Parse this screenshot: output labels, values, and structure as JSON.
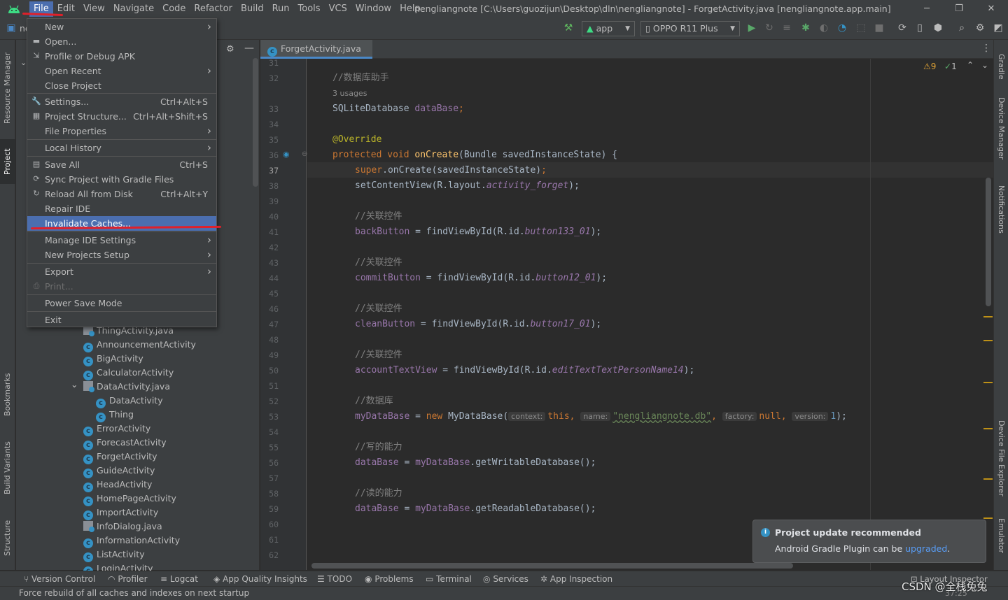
{
  "menubar": {
    "items": [
      "File",
      "Edit",
      "View",
      "Navigate",
      "Code",
      "Refactor",
      "Build",
      "Run",
      "Tools",
      "VCS",
      "Window",
      "Help"
    ]
  },
  "window": {
    "title": "nengliangnote [C:\\Users\\guozijun\\Desktop\\dln\\nengliangnote] - ForgetActivity.java [nengliangnote.app.main]",
    "minimize": "─",
    "maximize": "❐",
    "close": "✕"
  },
  "toolbar": {
    "project_crumb": "ne",
    "run_config": "app",
    "device": "OPPO R11 Plus"
  },
  "file_menu": {
    "items": [
      {
        "label": "New",
        "shortcut": "",
        "submenu": true
      },
      {
        "label": "Open...",
        "shortcut": "",
        "submenu": false
      },
      {
        "label": "Profile or Debug APK",
        "shortcut": "",
        "submenu": false
      },
      {
        "label": "Open Recent",
        "shortcut": "",
        "submenu": true
      },
      {
        "label": "Close Project",
        "shortcut": "",
        "submenu": false
      },
      {
        "label": "Settings...",
        "shortcut": "Ctrl+Alt+S",
        "submenu": false
      },
      {
        "label": "Project Structure...",
        "shortcut": "Ctrl+Alt+Shift+S",
        "submenu": false
      },
      {
        "label": "File Properties",
        "shortcut": "",
        "submenu": true
      },
      {
        "label": "Local History",
        "shortcut": "",
        "submenu": true
      },
      {
        "label": "Save All",
        "shortcut": "Ctrl+S",
        "submenu": false
      },
      {
        "label": "Sync Project with Gradle Files",
        "shortcut": "",
        "submenu": false
      },
      {
        "label": "Reload All from Disk",
        "shortcut": "Ctrl+Alt+Y",
        "submenu": false
      },
      {
        "label": "Repair IDE",
        "shortcut": "",
        "submenu": false
      },
      {
        "label": "Invalidate Caches...",
        "shortcut": "",
        "submenu": false
      },
      {
        "label": "Manage IDE Settings",
        "shortcut": "",
        "submenu": true
      },
      {
        "label": "New Projects Setup",
        "shortcut": "",
        "submenu": true
      },
      {
        "label": "Export",
        "shortcut": "",
        "submenu": true
      },
      {
        "label": "Print...",
        "shortcut": "",
        "submenu": false
      },
      {
        "label": "Power Save Mode",
        "shortcut": "",
        "submenu": false
      },
      {
        "label": "Exit",
        "shortcut": "",
        "submenu": false
      }
    ]
  },
  "project_tree": {
    "items": [
      {
        "label": "ThingActivity.java",
        "kind": "java"
      },
      {
        "label": "AnnouncementActivity",
        "kind": "class"
      },
      {
        "label": "BigActivity",
        "kind": "class"
      },
      {
        "label": "CalculatorActivity",
        "kind": "class"
      },
      {
        "label": "DataActivity.java",
        "kind": "java"
      },
      {
        "label": "DataActivity",
        "kind": "class"
      },
      {
        "label": "Thing",
        "kind": "class"
      },
      {
        "label": "ErrorActivity",
        "kind": "class"
      },
      {
        "label": "ForecastActivity",
        "kind": "class"
      },
      {
        "label": "ForgetActivity",
        "kind": "class"
      },
      {
        "label": "GuideActivity",
        "kind": "class"
      },
      {
        "label": "HeadActivity",
        "kind": "class"
      },
      {
        "label": "HomePageActivity",
        "kind": "class"
      },
      {
        "label": "ImportActivity",
        "kind": "class"
      },
      {
        "label": "InfoDialog.java",
        "kind": "java"
      },
      {
        "label": "InformationActivity",
        "kind": "class"
      },
      {
        "label": "ListActivity",
        "kind": "class"
      },
      {
        "label": "LoginActivity",
        "kind": "class"
      }
    ]
  },
  "left_tool_tabs": [
    "Resource Manager",
    "Project",
    "Bookmarks",
    "Build Variants",
    "Structure"
  ],
  "right_tool_tabs": [
    "Gradle",
    "Device Manager",
    "Notifications",
    "Device File Explorer",
    "Emulator"
  ],
  "editor": {
    "tab_label": "ForgetActivity.java",
    "warnings": "9",
    "weak_warnings": "1",
    "current_line": "37",
    "line_numbers": [
      "31",
      "32",
      "",
      "33",
      "34",
      "35",
      "36",
      "37",
      "38",
      "39",
      "40",
      "41",
      "42",
      "43",
      "44",
      "45",
      "46",
      "47",
      "48",
      "49",
      "50",
      "51",
      "52",
      "53",
      "54",
      "55",
      "56",
      "57",
      "58",
      "59",
      "60",
      "61",
      "62"
    ],
    "usages_label": "3 usages",
    "code": {
      "c32": "//数据库助手",
      "c33_type": "SQLiteDatabase ",
      "c33_field": "dataBase",
      "c35": "@Override",
      "c36_kw": "protected void ",
      "c36_method": "onCreate",
      "c36_rest": "(Bundle savedInstanceState) {",
      "c37_kw": "super",
      "c37_rest": ".onCreate(savedInstanceState)",
      "c38_a": "setContentView(R.layout.",
      "c38_b": "activity_forget",
      "c38_c": ");",
      "c40": "//关联控件",
      "c41_f": "backButton",
      "c41_a": " = findViewById(R.id.",
      "c41_b": "button133_01",
      "c41_c": ");",
      "c43": "//关联控件",
      "c44_f": "commitButton",
      "c44_a": " = findViewById(R.id.",
      "c44_b": "button12_01",
      "c44_c": ");",
      "c46": "//关联控件",
      "c47_f": "cleanButton",
      "c47_a": " = findViewById(R.id.",
      "c47_b": "button17_01",
      "c47_c": ");",
      "c49": "//关联控件",
      "c50_f": "accountTextView",
      "c50_a": " = findViewById(R.id.",
      "c50_b": "editTextTextPersonName14",
      "c50_c": ");",
      "c52": "//数据库",
      "c53_f": "myDataBase",
      "c53_a": " = ",
      "c53_new": "new ",
      "c53_b": "MyDataBase(",
      "c53_h1": "context:",
      "c53_this": "this",
      "c53_h2": "name:",
      "c53_str": "\"nengliangnote.db\"",
      "c53_h3": "factory:",
      "c53_null": "null",
      "c53_h4": "version:",
      "c53_num": "1",
      "c53_end": ");",
      "c55": "//写的能力",
      "c56_f": "dataBase",
      "c56_a": " = ",
      "c56_b": "myDataBase",
      "c56_c": ".getWritableDatabase();",
      "c58": "//读的能力",
      "c59_f": "dataBase",
      "c59_a": " = ",
      "c59_b": "myDataBase",
      "c59_c": ".getReadableDatabase();"
    }
  },
  "notification": {
    "title": "Project update recommended",
    "body": "Android Gradle Plugin can be ",
    "link": "upgraded",
    "tail": "."
  },
  "bottom_tools": [
    "Version Control",
    "Profiler",
    "Logcat",
    "App Quality Insights",
    "TODO",
    "Problems",
    "Terminal",
    "Services",
    "App Inspection",
    "Layout Inspector"
  ],
  "status": {
    "message": "Force rebuild of all caches and indexes on next startup",
    "position": "37:25",
    "watermark": "CSDN @全栈兔兔"
  },
  "colors": {
    "accent": "#4b6eaf",
    "annotation": "#e0202a"
  }
}
